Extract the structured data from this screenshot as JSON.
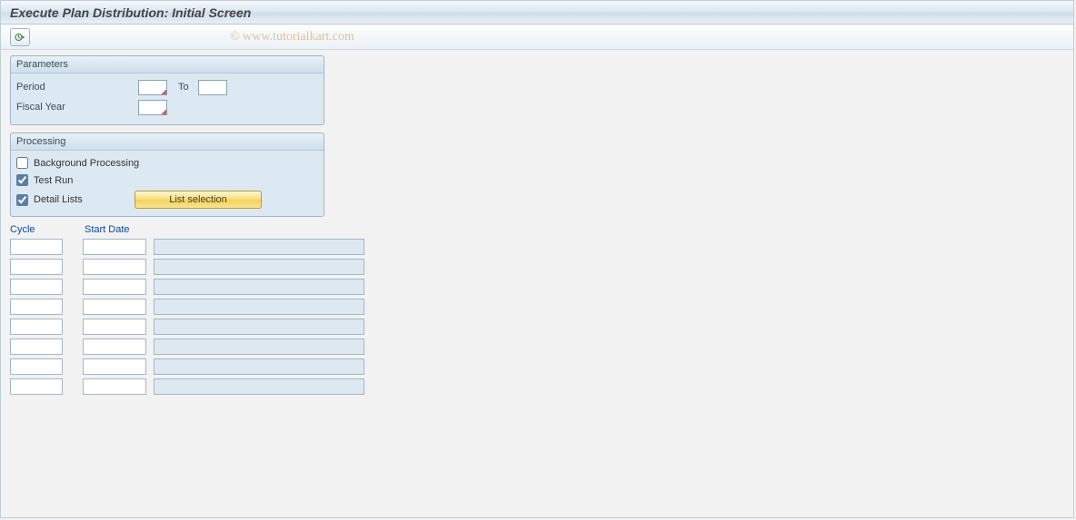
{
  "title": "Execute Plan Distribution: Initial Screen",
  "watermark": "© www.tutorialkart.com",
  "parameters": {
    "header": "Parameters",
    "period_label": "Period",
    "to_label": "To",
    "fiscal_year_label": "Fiscal Year"
  },
  "processing": {
    "header": "Processing",
    "background_label": "Background Processing",
    "testrun_label": "Test Run",
    "detail_label": "Detail Lists",
    "list_selection_button": "List selection"
  },
  "table": {
    "col_cycle": "Cycle",
    "col_start": "Start Date",
    "row_count": 8
  }
}
